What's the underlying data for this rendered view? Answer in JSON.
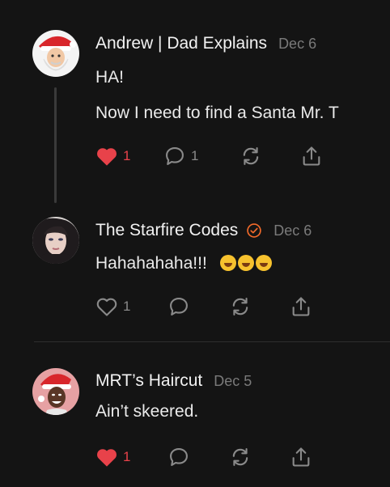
{
  "posts": [
    {
      "author": "Andrew | Dad Explains",
      "date": "Dec 6",
      "lines": [
        "HA!",
        "Now I need to find a Santa Mr. T"
      ],
      "likes": "1",
      "liked": true,
      "replies": "1"
    },
    {
      "author": "The Starfire Codes",
      "date": "Dec 6",
      "text": "Hahahahaha!!!",
      "emoji": [
        "rofl-emoji",
        "rofl-emoji",
        "rofl-emoji"
      ],
      "likes": "1",
      "liked": false,
      "replies": ""
    },
    {
      "author": "MRT’s Haircut",
      "date": "Dec 5",
      "text": "Ain’t skeered.",
      "likes": "1",
      "liked": true,
      "replies": ""
    }
  ],
  "colors": {
    "background": "#141414",
    "like_red": "#e8424a",
    "verified_orange": "#f26a2a",
    "icon_grey": "#8a8a8a"
  },
  "icons": [
    "heart-icon",
    "reply-icon",
    "repost-icon",
    "share-icon",
    "verified-icon"
  ]
}
